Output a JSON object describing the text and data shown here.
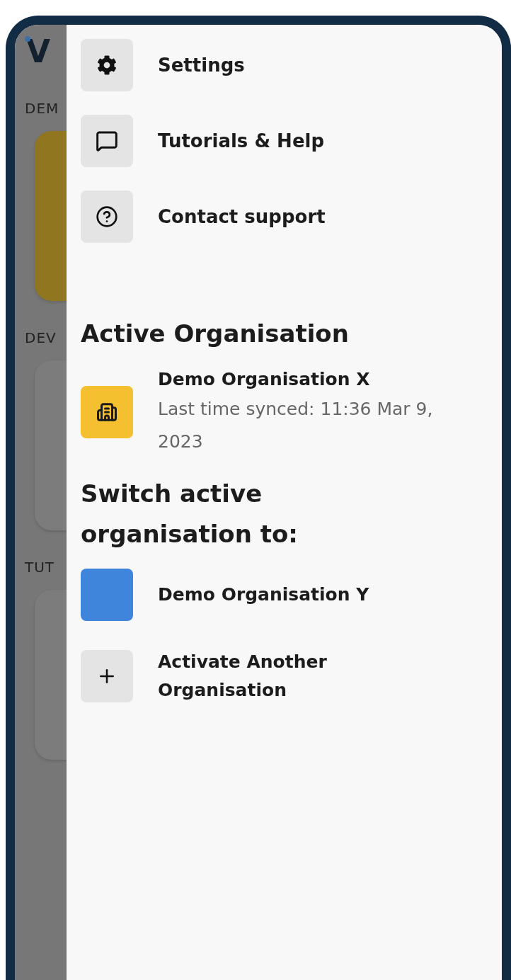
{
  "background": {
    "logo": "V",
    "sections": [
      {
        "label": "DEM",
        "kind": "yellow"
      },
      {
        "label": "DEV",
        "kind": "gray"
      },
      {
        "label": "TUT",
        "kind": "gray"
      }
    ]
  },
  "drawer": {
    "menu": [
      {
        "kind": "settings",
        "label": "Settings"
      },
      {
        "kind": "tutorials",
        "label": "Tutorials & Help"
      },
      {
        "kind": "support",
        "label": "Contact support"
      }
    ],
    "active_heading": "Active Organisation",
    "active_org": {
      "name": "Demo Organisation X",
      "color": "#f5c030",
      "synced": "Last time synced: 11:36 Mar 9, 2023"
    },
    "switch_heading": "Switch active organisation to:",
    "orgs": [
      {
        "kind": "org",
        "name": "Demo Organisation Y",
        "color": "#3f85dc"
      },
      {
        "kind": "add",
        "name": "Activate Another Organisation"
      }
    ]
  }
}
